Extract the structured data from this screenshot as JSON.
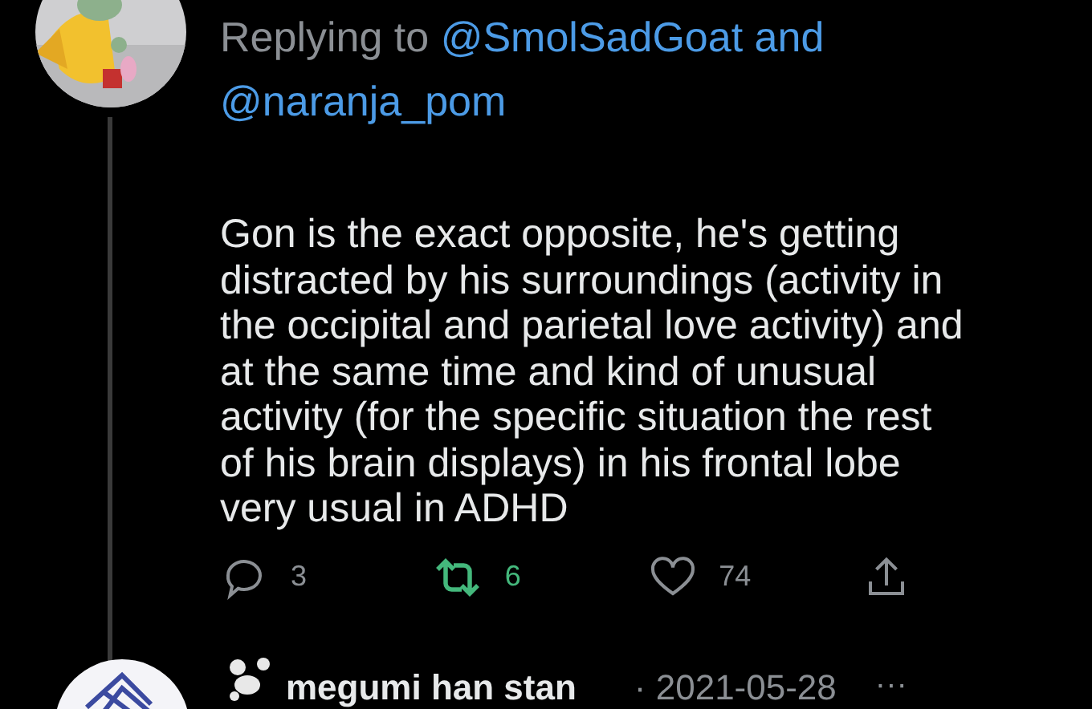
{
  "reply": {
    "replying_prefix": "Replying to",
    "mentions": [
      "@SmolSadGoat and",
      "@naranja_pom"
    ],
    "body_lines": [
      "Gon is the exact opposite, he's getting",
      "distracted by his surroundings (activity in",
      "the occipital and parietal love activity) and",
      "at the same time and kind of unusual",
      "activity (for the specific situation the rest",
      "of his brain displays) in his frontal lobe",
      "very usual in ADHD"
    ],
    "actions": [
      {
        "kind": "reply",
        "count": "3",
        "active": false
      },
      {
        "kind": "retweet",
        "count": "6",
        "active": true
      },
      {
        "kind": "like",
        "count": "74",
        "active": false
      },
      {
        "kind": "share"
      }
    ]
  },
  "next_tweet": {
    "name": "megumi han stan",
    "date": "· 2021-05-28",
    "more": "···"
  }
}
